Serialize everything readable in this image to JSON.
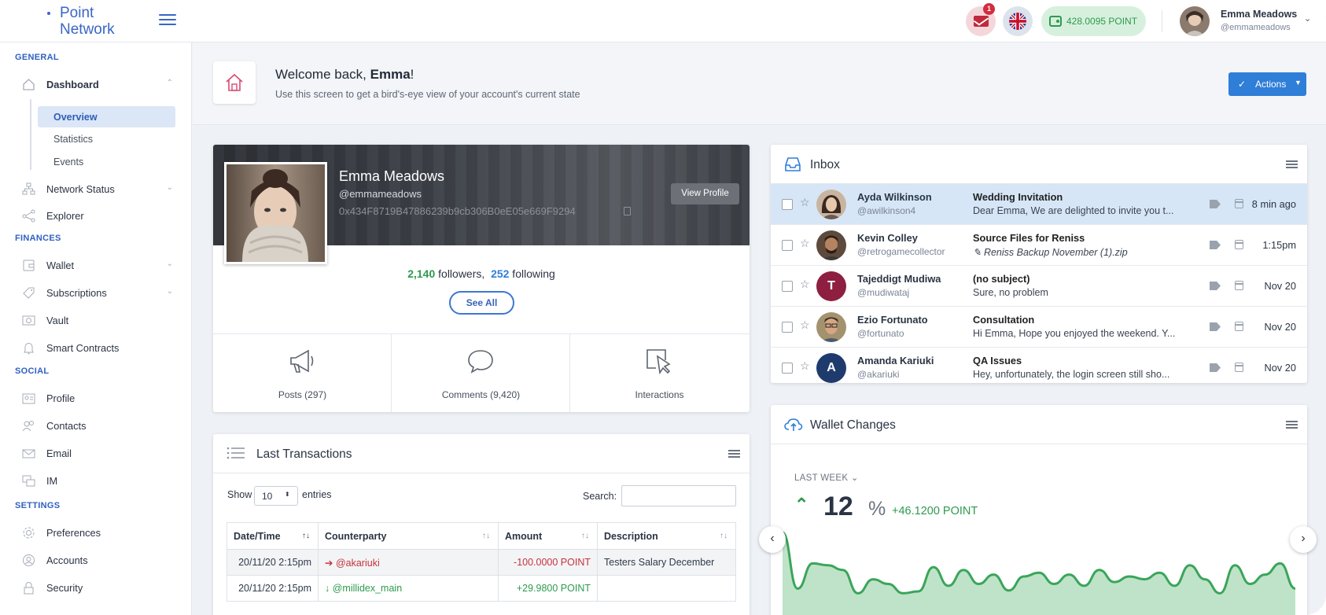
{
  "brand": {
    "line1": "Point",
    "line2": "Network"
  },
  "topbar": {
    "mail_badge": "1",
    "wallet_balance": "428.0095 POINT",
    "user_name": "Emma Meadows",
    "user_handle": "@emmameadows"
  },
  "sidebar": {
    "general": "GENERAL",
    "dashboard": "Dashboard",
    "overview": "Overview",
    "statistics": "Statistics",
    "events": "Events",
    "network_status": "Network Status",
    "explorer": "Explorer",
    "finances": "FINANCES",
    "wallet": "Wallet",
    "subscriptions": "Subscriptions",
    "vault": "Vault",
    "smart_contracts": "Smart Contracts",
    "social": "SOCIAL",
    "profile": "Profile",
    "contacts": "Contacts",
    "email": "Email",
    "im": "IM",
    "settings": "SETTINGS",
    "preferences": "Preferences",
    "accounts": "Accounts",
    "security": "Security"
  },
  "header": {
    "welcome_prefix": "Welcome back, ",
    "welcome_name": "Emma",
    "welcome_suffix": "!",
    "subtitle": "Use this screen to get a bird's-eye view of your account's current state",
    "actions_label": "Actions"
  },
  "profile": {
    "name": "Emma Meadows",
    "handle": "@emmameadows",
    "address": "0x434F8719B47886239b9cb306B0eE05e669F9294",
    "view_profile": "View Profile",
    "followers_count": "2,140",
    "followers_label": " followers,",
    "following_count": "252",
    "following_label": " following",
    "see_all": "See All",
    "stats": [
      {
        "label": "Posts (297)",
        "icon": "megaphone-icon"
      },
      {
        "label": "Comments (9,420)",
        "icon": "comment-bubble-icon"
      },
      {
        "label": "Interactions",
        "icon": "cursor-click-icon"
      }
    ]
  },
  "inbox": {
    "title": "Inbox",
    "rows": [
      {
        "sender": "Ayda Wilkinson",
        "handle": "@awilkinson4",
        "subject": "Wedding Invitation",
        "preview": "Dear Emma, We are delighted to invite you t...",
        "time": "8 min ago",
        "avatar": "photo"
      },
      {
        "sender": "Kevin Colley",
        "handle": "@retrogamecollector",
        "subject": "Source Files for Reniss",
        "preview": "Reniss Backup November (1).zip",
        "time": "1:15pm",
        "avatar": "photo"
      },
      {
        "sender": "Tajeddigt Mudiwa",
        "handle": "@mudiwataj",
        "subject": "(no subject)",
        "preview": "Sure, no problem",
        "time": "Nov 20",
        "avatar": "T"
      },
      {
        "sender": "Ezio Fortunato",
        "handle": "@fortunato",
        "subject": "Consultation",
        "preview": "Hi Emma, Hope you enjoyed the weekend. Y...",
        "time": "Nov 20",
        "avatar": "photo"
      },
      {
        "sender": "Amanda Kariuki",
        "handle": "@akariuki",
        "subject": "QA Issues",
        "preview": "Hey, unfortunately, the login screen still sho...",
        "time": "Nov 20",
        "avatar": "A"
      }
    ]
  },
  "transactions": {
    "title": "Last Transactions",
    "show": "Show",
    "page_size": "10",
    "entries": "entries",
    "search": "Search:",
    "columns": [
      "Date/Time",
      "Counterparty",
      "Amount",
      "Description"
    ],
    "rows": [
      {
        "datetime": "20/11/20 2:15pm",
        "counterparty": "@akariuki",
        "amount": "-100.0000 POINT",
        "description": "Testers Salary December",
        "direction": "out"
      },
      {
        "datetime": "20/11/20 2:15pm",
        "counterparty": "@millidex_main",
        "amount": "+29.9800 POINT",
        "description": "",
        "direction": "in"
      }
    ]
  },
  "wallet_changes": {
    "title": "Wallet Changes",
    "period": "LAST WEEK",
    "change_value": "12",
    "change_unit": "%",
    "change_points": "+46.1200 POINT",
    "colors": {
      "line": "#3aa55a",
      "fill": "#bfe3c8"
    }
  },
  "chart_data": {
    "type": "area",
    "values": [
      95,
      35,
      62,
      60,
      55,
      30,
      45,
      40,
      30,
      32,
      58,
      38,
      55,
      40,
      50,
      33,
      48,
      52,
      40,
      50,
      38,
      55,
      42,
      48,
      45,
      52,
      38,
      60,
      45,
      30,
      60,
      40,
      50,
      62,
      35
    ],
    "title": "",
    "xlabel": "",
    "ylabel": ""
  }
}
